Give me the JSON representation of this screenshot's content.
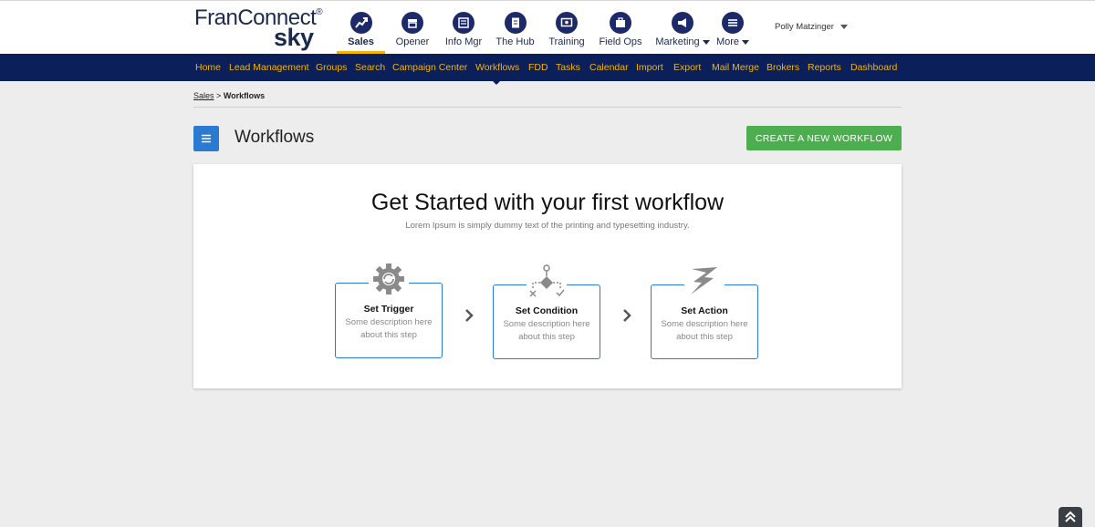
{
  "brand": {
    "name": "FranConnect",
    "reg": "®",
    "sub": "sky"
  },
  "modules": [
    {
      "label": "Sales",
      "icon": "sales-trend-icon",
      "active": true
    },
    {
      "label": "Opener",
      "icon": "store-icon"
    },
    {
      "label": "Info Mgr",
      "icon": "info-manager-icon"
    },
    {
      "label": "The Hub",
      "icon": "document-icon"
    },
    {
      "label": "Training",
      "icon": "training-icon"
    },
    {
      "label": "Field Ops",
      "icon": "field-ops-icon"
    },
    {
      "label": "Marketing",
      "icon": "megaphone-icon",
      "dropdown": true
    },
    {
      "label": "More",
      "icon": "hamburger-icon",
      "dropdown": true
    }
  ],
  "user": {
    "name": "Polly Matzinger"
  },
  "subnav": [
    "Home",
    "Lead Management",
    "Groups",
    "Search",
    "Campaign Center",
    "Workflows",
    "FDD",
    "Tasks",
    "Calendar",
    "Import",
    "Export",
    "Mail Merge",
    "Brokers",
    "Reports",
    "Dashboard"
  ],
  "breadcrumb": {
    "parent": "Sales",
    "separator": ">",
    "current": "Workflows"
  },
  "page": {
    "title": "Workflows",
    "create_button": "CREATE A NEW WORKFLOW"
  },
  "empty_state": {
    "title": "Get Started with your first workflow",
    "subtitle": "Lorem Ipsum is simply dummy text of the printing and typesetting industry.",
    "steps": [
      {
        "title": "Set Trigger",
        "description": "Some description here about this step",
        "icon": "gear-refresh-icon"
      },
      {
        "title": "Set Condition",
        "description": "Some description here about this step",
        "icon": "condition-branch-icon"
      },
      {
        "title": "Set Action",
        "description": "Some description here about this step",
        "icon": "lightning-icon"
      }
    ]
  },
  "colors": {
    "navy": "#0b1f5a",
    "nav_text": "#f5b400",
    "accent_blue": "#2a7ad1",
    "create_green": "#4cae4f",
    "background": "#ededed"
  }
}
